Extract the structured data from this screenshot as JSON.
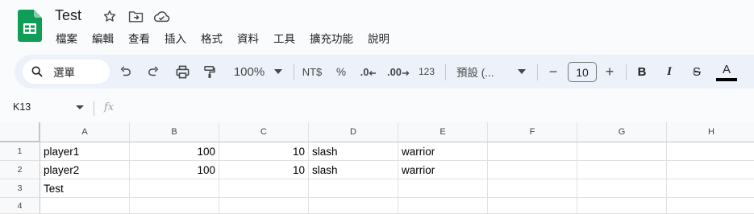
{
  "app": {
    "name": "Google Sheets"
  },
  "document": {
    "title": "Test"
  },
  "title_icons": [
    "star-icon",
    "move-to-folder-icon",
    "cloud-saved-icon"
  ],
  "menu": [
    "檔案",
    "編輯",
    "查看",
    "插入",
    "格式",
    "資料",
    "工具",
    "擴充功能",
    "說明"
  ],
  "toolbar": {
    "search_label": "選單",
    "zoom": "100%",
    "currency": "NT$",
    "percent": "%",
    "decrease_decimal": ".0",
    "increase_decimal": ".00",
    "more_formats": "123",
    "font": "預設 (...",
    "font_size": "10",
    "minus": "−",
    "plus": "+",
    "bold": "B",
    "italic": "I",
    "strike": "S",
    "text_color": "A"
  },
  "formula_bar": {
    "name_box": "K13",
    "fx": "fx",
    "value": ""
  },
  "grid": {
    "columns": [
      "A",
      "B",
      "C",
      "D",
      "E",
      "F",
      "G",
      "H"
    ],
    "rows": [
      {
        "num": "1",
        "cells": [
          "player1",
          "100",
          "10",
          "slash",
          "warrior",
          "",
          "",
          ""
        ]
      },
      {
        "num": "2",
        "cells": [
          "player2",
          "100",
          "10",
          "slash",
          "warrior",
          "",
          "",
          ""
        ]
      },
      {
        "num": "3",
        "cells": [
          "Test",
          "",
          "",
          "",
          "",
          "",
          "",
          ""
        ]
      },
      {
        "num": "4",
        "cells": [
          "",
          "",
          "",
          "",
          "",
          "",
          "",
          ""
        ]
      }
    ]
  },
  "colors": {
    "sheets_green": "#0f9d58",
    "toolbar_bg": "#edf2fa",
    "page_bg": "#f9fbfd"
  }
}
